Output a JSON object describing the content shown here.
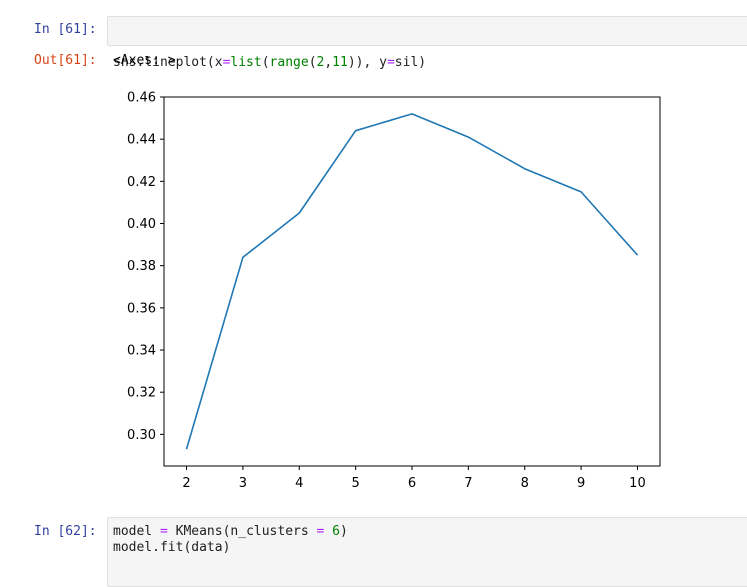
{
  "cells": [
    {
      "prompt": "In [61]:",
      "code_tokens": [
        {
          "t": "sns.lineplot(x",
          "c": ""
        },
        {
          "t": "=",
          "c": "op"
        },
        {
          "t": "list",
          "c": "kw"
        },
        {
          "t": "(",
          "c": ""
        },
        {
          "t": "range",
          "c": "kw"
        },
        {
          "t": "(",
          "c": ""
        },
        {
          "t": "2",
          "c": "num"
        },
        {
          "t": ",",
          "c": ""
        },
        {
          "t": "11",
          "c": "num"
        },
        {
          "t": ")), y",
          "c": ""
        },
        {
          "t": "=",
          "c": "op"
        },
        {
          "t": "sil)",
          "c": ""
        }
      ],
      "output_prompt": "Out[61]:",
      "output_text": "<Axes: >"
    },
    {
      "prompt": "In [62]:",
      "lines": [
        [
          {
            "t": "model ",
            "c": ""
          },
          {
            "t": "=",
            "c": "op"
          },
          {
            "t": " KMeans(n_clusters ",
            "c": ""
          },
          {
            "t": "=",
            "c": "op"
          },
          {
            "t": " ",
            "c": ""
          },
          {
            "t": "6",
            "c": "num"
          },
          {
            "t": ")",
            "c": ""
          }
        ],
        [
          {
            "t": "model.fit(data)",
            "c": ""
          }
        ]
      ]
    }
  ],
  "chart_data": {
    "type": "line",
    "title": "",
    "xlabel": "",
    "ylabel": "",
    "x": [
      2,
      3,
      4,
      5,
      6,
      7,
      8,
      9,
      10
    ],
    "series": [
      {
        "values": [
          0.293,
          0.384,
          0.405,
          0.444,
          0.452,
          0.441,
          0.426,
          0.415,
          0.385
        ],
        "color": "#1f77b4"
      }
    ],
    "xlim": [
      1.6,
      10.4
    ],
    "ylim": [
      0.285,
      0.46
    ],
    "xticks": [
      "2",
      "3",
      "4",
      "5",
      "6",
      "7",
      "8",
      "9",
      "10"
    ],
    "xtick_values": [
      2,
      3,
      4,
      5,
      6,
      7,
      8,
      9,
      10
    ],
    "yticks": [
      "0.30",
      "0.32",
      "0.34",
      "0.36",
      "0.38",
      "0.40",
      "0.42",
      "0.44",
      "0.46"
    ],
    "ytick_values": [
      0.3,
      0.32,
      0.34,
      0.36,
      0.38,
      0.4,
      0.42,
      0.44,
      0.46
    ],
    "grid": false
  }
}
